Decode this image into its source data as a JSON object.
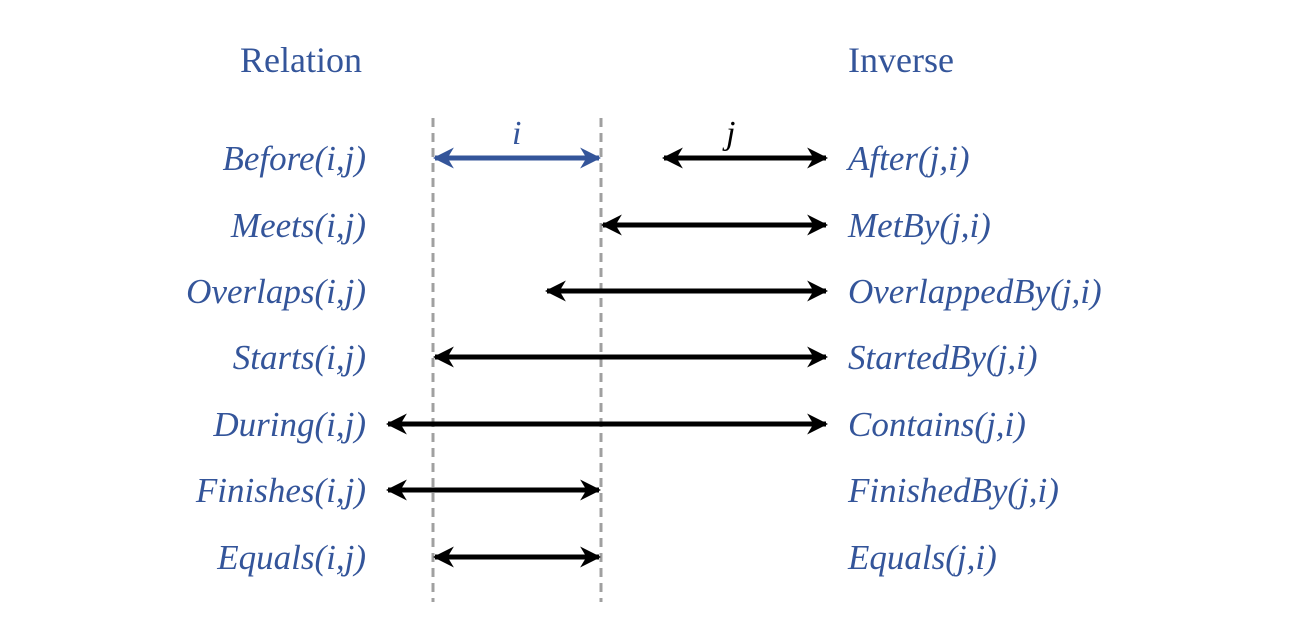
{
  "headers": {
    "relation": "Relation",
    "inverse": "Inverse"
  },
  "interval_labels": {
    "i": "i",
    "j": "j"
  },
  "colors": {
    "text": "#34559a",
    "interval_i": "#34559a",
    "interval_j": "#000000",
    "guides": "#a0a0a0"
  },
  "rows": [
    {
      "relation": "Before(i,j)",
      "inverse": "After(j,i)"
    },
    {
      "relation": "Meets(i,j)",
      "inverse": "MetBy(j,i)"
    },
    {
      "relation": "Overlaps(i,j)",
      "inverse": "OverlappedBy(j,i)"
    },
    {
      "relation": "Starts(i,j)",
      "inverse": "StartedBy(j,i)"
    },
    {
      "relation": "During(i,j)",
      "inverse": "Contains(j,i)"
    },
    {
      "relation": "Finishes(i,j)",
      "inverse": "FinishedBy(j,i)"
    },
    {
      "relation": "Equals(i,j)",
      "inverse": "Equals(j,i)"
    }
  ]
}
